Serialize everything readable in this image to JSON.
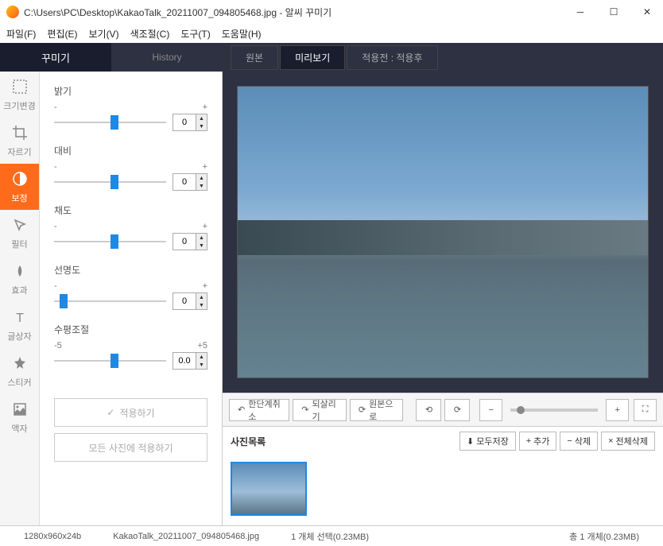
{
  "titlebar": {
    "path": "C:\\Users\\PC\\Desktop\\KakaoTalk_20211007_094805468.jpg - 알씨 꾸미기"
  },
  "menu": {
    "file": "파일(F)",
    "edit": "편집(E)",
    "view": "보기(V)",
    "color": "색조절(C)",
    "tools": "도구(T)",
    "help": "도움말(H)"
  },
  "tabs": {
    "decorate": "꾸미기",
    "history": "History"
  },
  "viewTabs": {
    "original": "원본",
    "preview": "미리보기",
    "beforeAfter": "적용전 : 적용후"
  },
  "tools": {
    "resize": "크기변경",
    "crop": "자르기",
    "adjust": "보정",
    "filter": "필터",
    "effect": "효과",
    "text": "글상자",
    "sticker": "스티커",
    "frame": "액자"
  },
  "controls": {
    "brightness": {
      "label": "밝기",
      "min": "-",
      "max": "+",
      "value": "0",
      "pos": 50
    },
    "contrast": {
      "label": "대비",
      "min": "-",
      "max": "+",
      "value": "0",
      "pos": 50
    },
    "saturation": {
      "label": "채도",
      "min": "-",
      "max": "+",
      "value": "0",
      "pos": 50
    },
    "sharpness": {
      "label": "선명도",
      "min": "-",
      "max": "+",
      "value": "0",
      "pos": 5
    },
    "level": {
      "label": "수평조절",
      "min": "-5",
      "max": "+5",
      "value": "0.0",
      "pos": 50
    }
  },
  "buttons": {
    "apply": "적용하기",
    "applyAll": "모든 사진에 적용하기"
  },
  "bottomToolbar": {
    "undo": "한단계취소",
    "revert": "되살리기",
    "toOriginal": "원본으로"
  },
  "filmstrip": {
    "title": "사진목록",
    "saveAll": "모두저장",
    "add": "추가",
    "remove": "삭제",
    "removeAll": "전체삭제"
  },
  "status": {
    "dimensions": "1280x960x24b",
    "filename": "KakaoTalk_20211007_094805468.jpg",
    "selection": "1 개체 선택(0.23MB)",
    "total": "총 1 개체(0.23MB)"
  }
}
